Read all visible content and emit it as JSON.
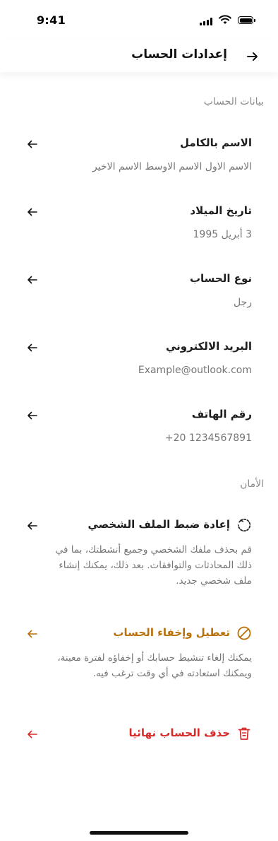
{
  "status_bar": {
    "time": "9:41"
  },
  "header": {
    "title": "إعدادات الحساب"
  },
  "account_section": {
    "title": "بيانات الحساب",
    "items": [
      {
        "label": "الاسم بالكامل",
        "value": "الاسم الاول الاسم الاوسط الاسم الاخير"
      },
      {
        "label": "تاريخ الميلاد",
        "value": "3 أبريل 1995"
      },
      {
        "label": "نوع الحساب",
        "value": "رجل"
      },
      {
        "label": "البريد الالكتروني",
        "value": "Example@outlook.com"
      },
      {
        "label": "رقم الهاتف",
        "value": "+20 1234567891"
      }
    ]
  },
  "security_section": {
    "title": "الأمان",
    "reset_profile": {
      "label": "إعادة ضبط الملف الشخصي",
      "description": "قم بحذف ملفك الشخصي وجميع أنشطتك، بما في ذلك المحادثات والتوافقات. بعد ذلك، يمكنك إنشاء ملف شخصي جديد."
    },
    "deactivate": {
      "label": "تعطيل وإخفاء الحساب",
      "description": "يمكنك إلغاء تنشيط حسابك أو إخفاؤه لفترة معينة، ويمكنك استعادته في أي وقت ترغب فيه."
    },
    "delete": {
      "label": "حذف الحساب نهائيا"
    }
  },
  "colors": {
    "warning": "#b7700a",
    "danger": "#d62b2b",
    "muted_text": "#767676"
  }
}
